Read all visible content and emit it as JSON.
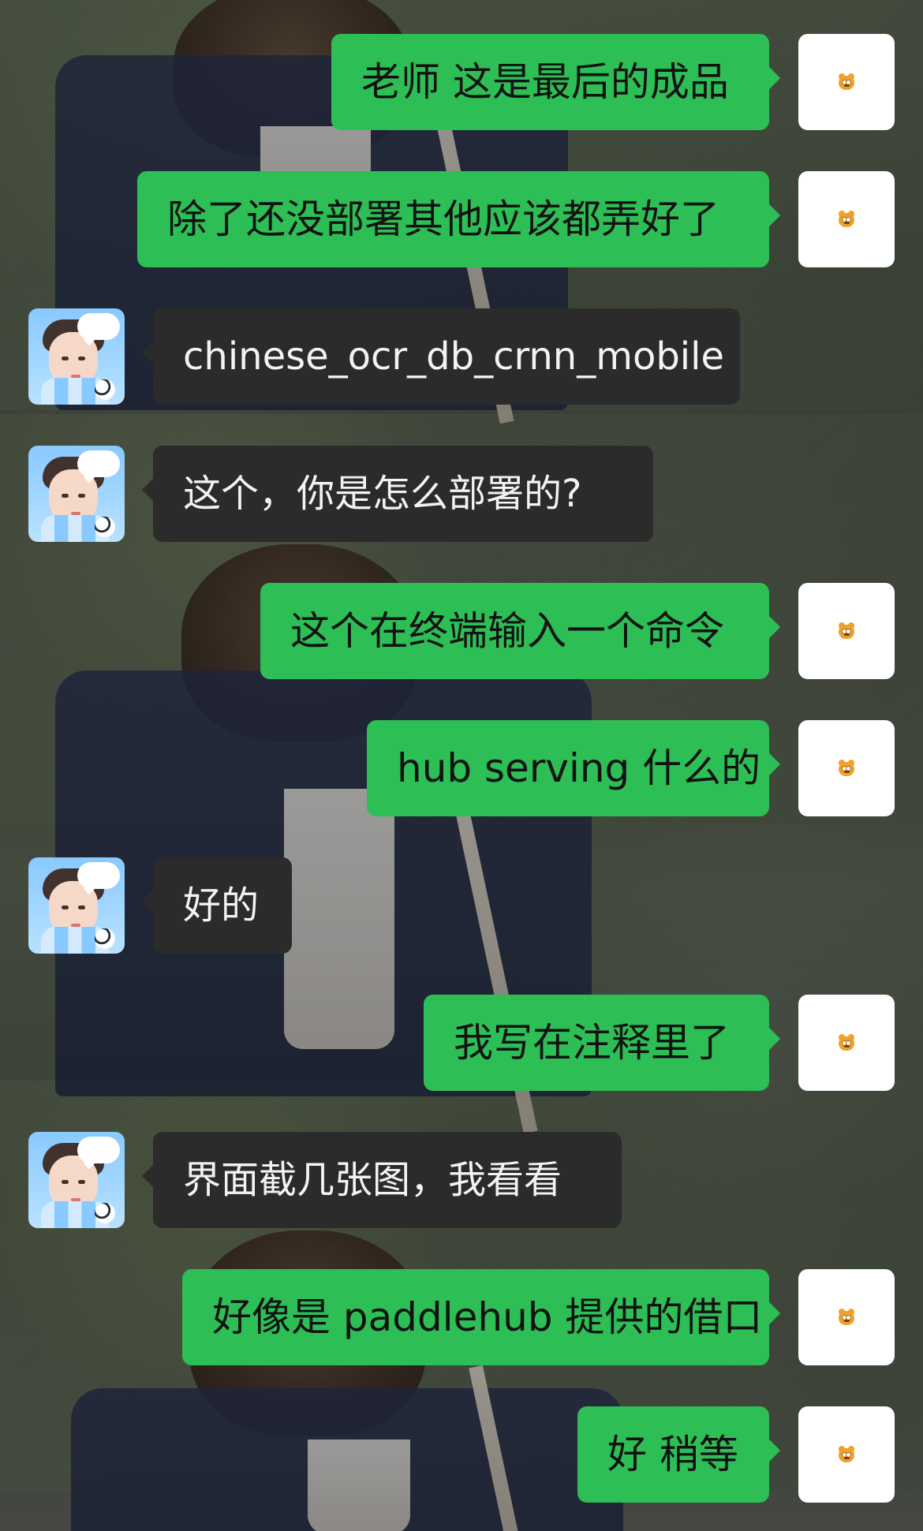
{
  "messages": [
    {
      "side": "right",
      "text": "老师 这是最后的成品",
      "avatar": "garfield-icon"
    },
    {
      "side": "right",
      "text": "除了还没部署其他应该都弄好了",
      "avatar": "garfield-icon"
    },
    {
      "side": "left",
      "text": "chinese_ocr_db_crnn_mobile",
      "avatar": "cartoon-boy-icon"
    },
    {
      "side": "left",
      "text": "这个，你是怎么部署的?",
      "avatar": "cartoon-boy-icon"
    },
    {
      "side": "right",
      "text": "这个在终端输入一个命令",
      "avatar": "garfield-icon"
    },
    {
      "side": "right",
      "text": "hub serving 什么的",
      "avatar": "garfield-icon"
    },
    {
      "side": "left",
      "text": "好的",
      "avatar": "cartoon-boy-icon"
    },
    {
      "side": "right",
      "text": "我写在注释里了",
      "avatar": "garfield-icon"
    },
    {
      "side": "left",
      "text": "界面截几张图，我看看",
      "avatar": "cartoon-boy-icon"
    },
    {
      "side": "right",
      "text": "好像是 paddlehub 提供的借口",
      "avatar": "garfield-icon"
    },
    {
      "side": "right",
      "text": "好 稍等",
      "avatar": "garfield-icon"
    }
  ]
}
